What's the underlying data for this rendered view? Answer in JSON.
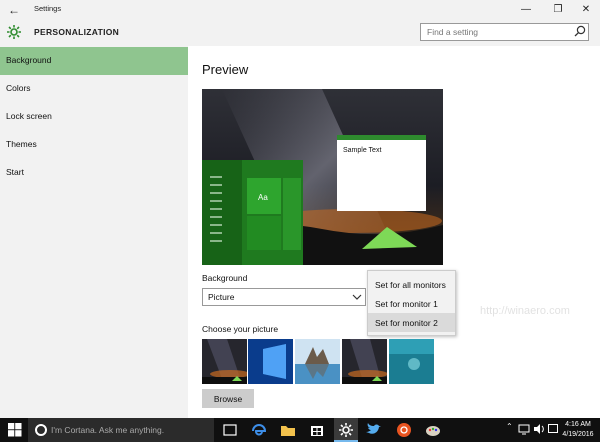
{
  "window": {
    "title": "Settings",
    "controls": {
      "minimize": "—",
      "maximize": "❐",
      "close": "✕"
    }
  },
  "header": {
    "page_title": "PERSONALIZATION",
    "search_placeholder": "Find a setting"
  },
  "sidebar": {
    "items": [
      {
        "label": "Background",
        "selected": true
      },
      {
        "label": "Colors"
      },
      {
        "label": "Lock screen"
      },
      {
        "label": "Themes"
      },
      {
        "label": "Start"
      }
    ]
  },
  "main": {
    "preview_heading": "Preview",
    "sample_text": "Sample Text",
    "tile_label": "Aa",
    "background_label": "Background",
    "background_value": "Picture",
    "choose_picture_label": "Choose your picture",
    "browse_label": "Browse",
    "watermark": "http://winaero.com"
  },
  "context_menu": {
    "items": [
      {
        "label": "Set for all monitors"
      },
      {
        "label": "Set for monitor 1"
      },
      {
        "label": "Set for monitor 2",
        "highlighted": true
      }
    ]
  },
  "taskbar": {
    "cortana_placeholder": "I'm Cortana. Ask me anything.",
    "apps": [
      "task-view",
      "edge",
      "file-explorer",
      "store",
      "settings",
      "twitter",
      "ubuntu",
      "paint"
    ],
    "time": "4:16 AM",
    "date": "4/19/2016",
    "tray_chevron": "⌃"
  },
  "colors": {
    "accent_green": "#2e8b2e",
    "selected_nav": "#8fc58f",
    "taskbar": "#101010"
  }
}
